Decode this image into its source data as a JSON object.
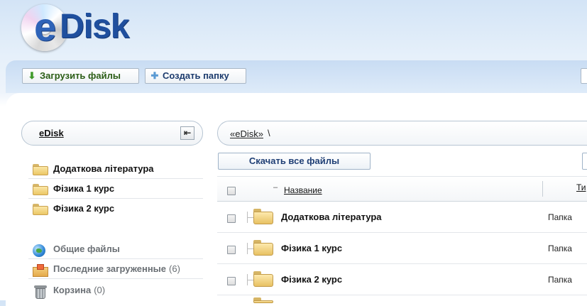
{
  "app": {
    "logo_text": "eDisk"
  },
  "toolbar": {
    "upload_label": "Загрузить файлы",
    "new_folder_label": "Создать папку"
  },
  "sidebar": {
    "title": "eDisk",
    "folders": [
      {
        "label": "Додаткова література"
      },
      {
        "label": "Фізика 1 курс"
      },
      {
        "label": "Фізика 2 курс"
      }
    ],
    "sections": {
      "shared": {
        "label": "Общие файлы"
      },
      "recent": {
        "label": "Последние загруженные",
        "count": "(6)"
      },
      "trash": {
        "label": "Корзина",
        "count": "(0)"
      }
    }
  },
  "main": {
    "breadcrumb": {
      "root": "«eDisk»",
      "separator": "\\"
    },
    "download_all_label": "Скачать все файлы",
    "columns": {
      "sort_indicator": "–",
      "name": "Название",
      "type": "Ти"
    },
    "rows": [
      {
        "name": "Додаткова література",
        "type": "Папка"
      },
      {
        "name": "Фізика 1 курс",
        "type": "Папка"
      },
      {
        "name": "Фізика 2 курс",
        "type": "Папка"
      }
    ]
  },
  "colors": {
    "brand_blue": "#1f4f9e",
    "folder_yellow": "#ebc766",
    "toolbar_blue": "#c8dcf3"
  }
}
